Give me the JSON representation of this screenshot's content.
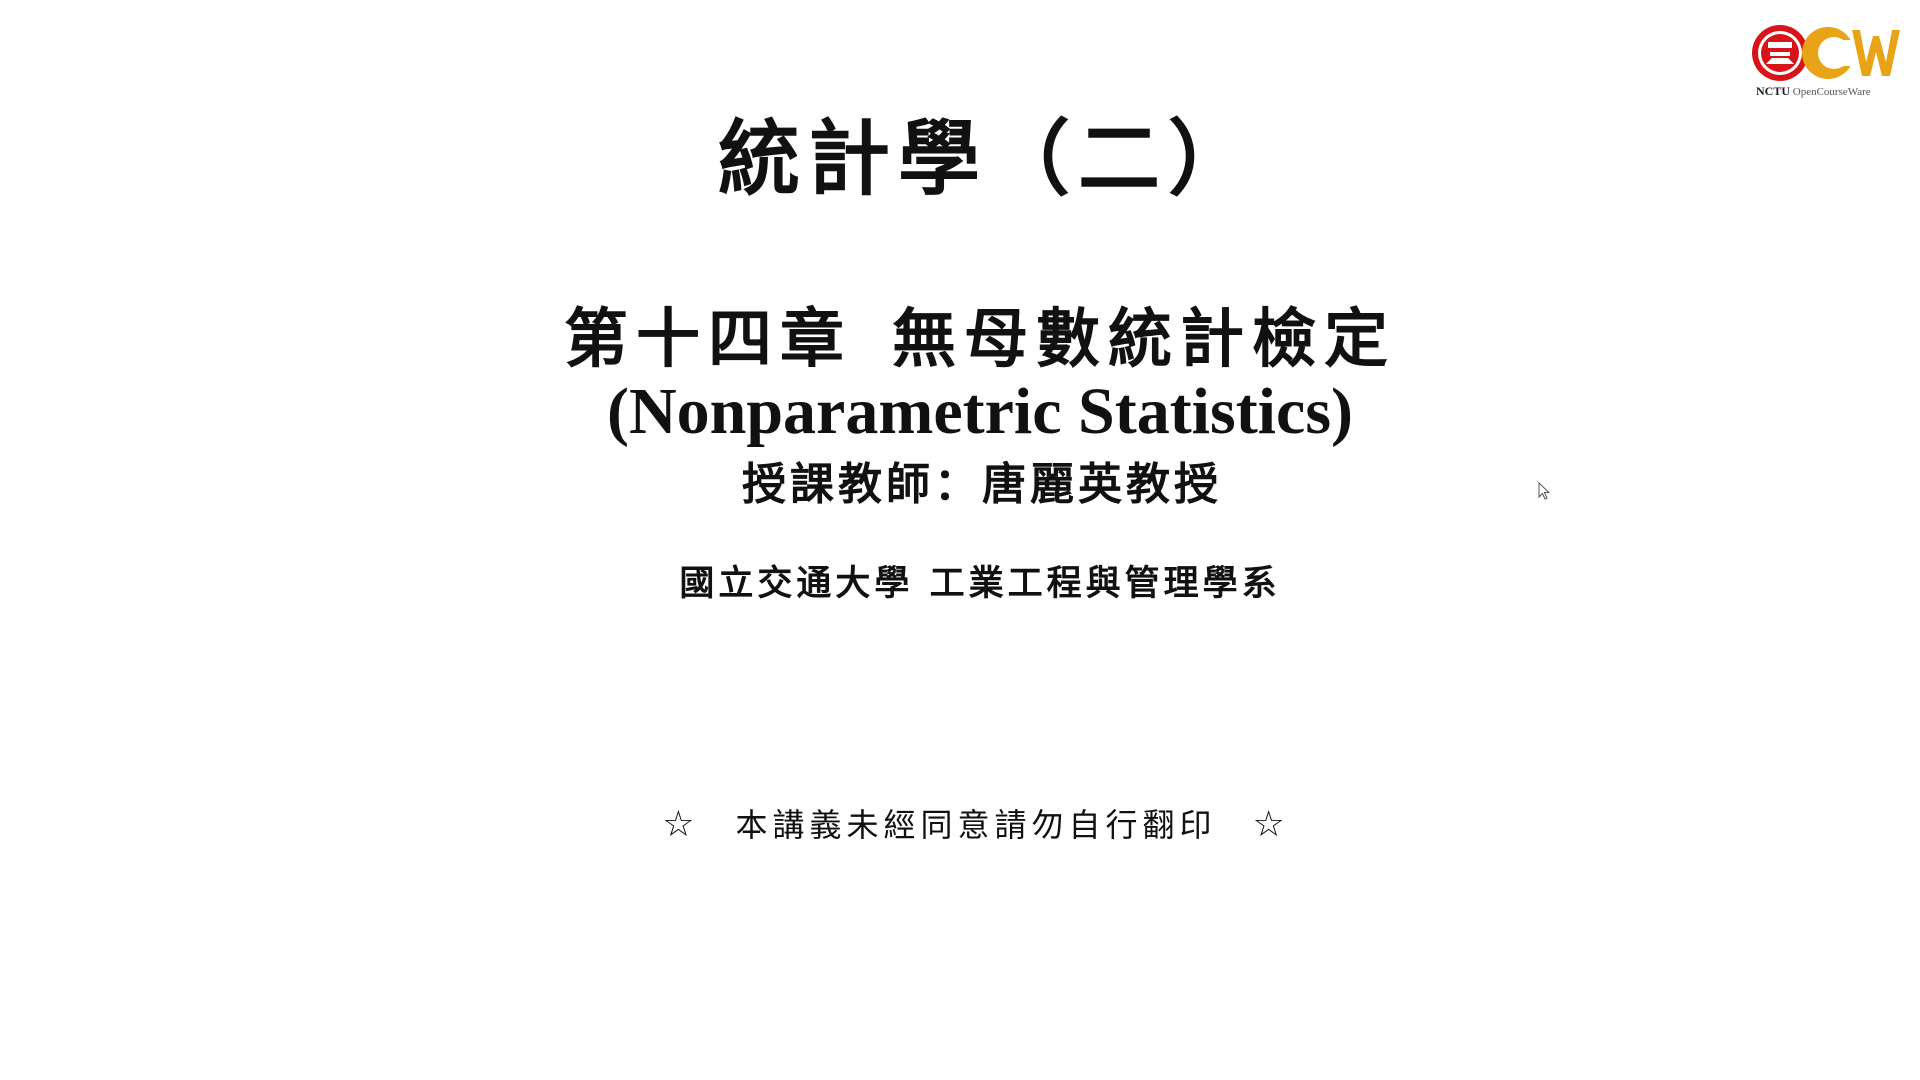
{
  "slide": {
    "course_title": "統計學（二）",
    "chapter_number": "第十四章",
    "chapter_name": "無母數統計檢定",
    "english_title": "(Nonparametric Statistics)",
    "instructor": "授課教師：唐麗英教授",
    "department": "國立交通大學 工業工程與管理學系",
    "notice": {
      "star_left": "☆",
      "text": "本講義未經同意請勿自行翻印",
      "star_right": "☆"
    }
  },
  "logo": {
    "caption_bold": "NCTU",
    "caption": "OpenCourseWare",
    "colors": {
      "red": "#d7141a",
      "gold": "#e8a317"
    }
  },
  "cursor": {
    "icon": "mouse-pointer-icon"
  }
}
